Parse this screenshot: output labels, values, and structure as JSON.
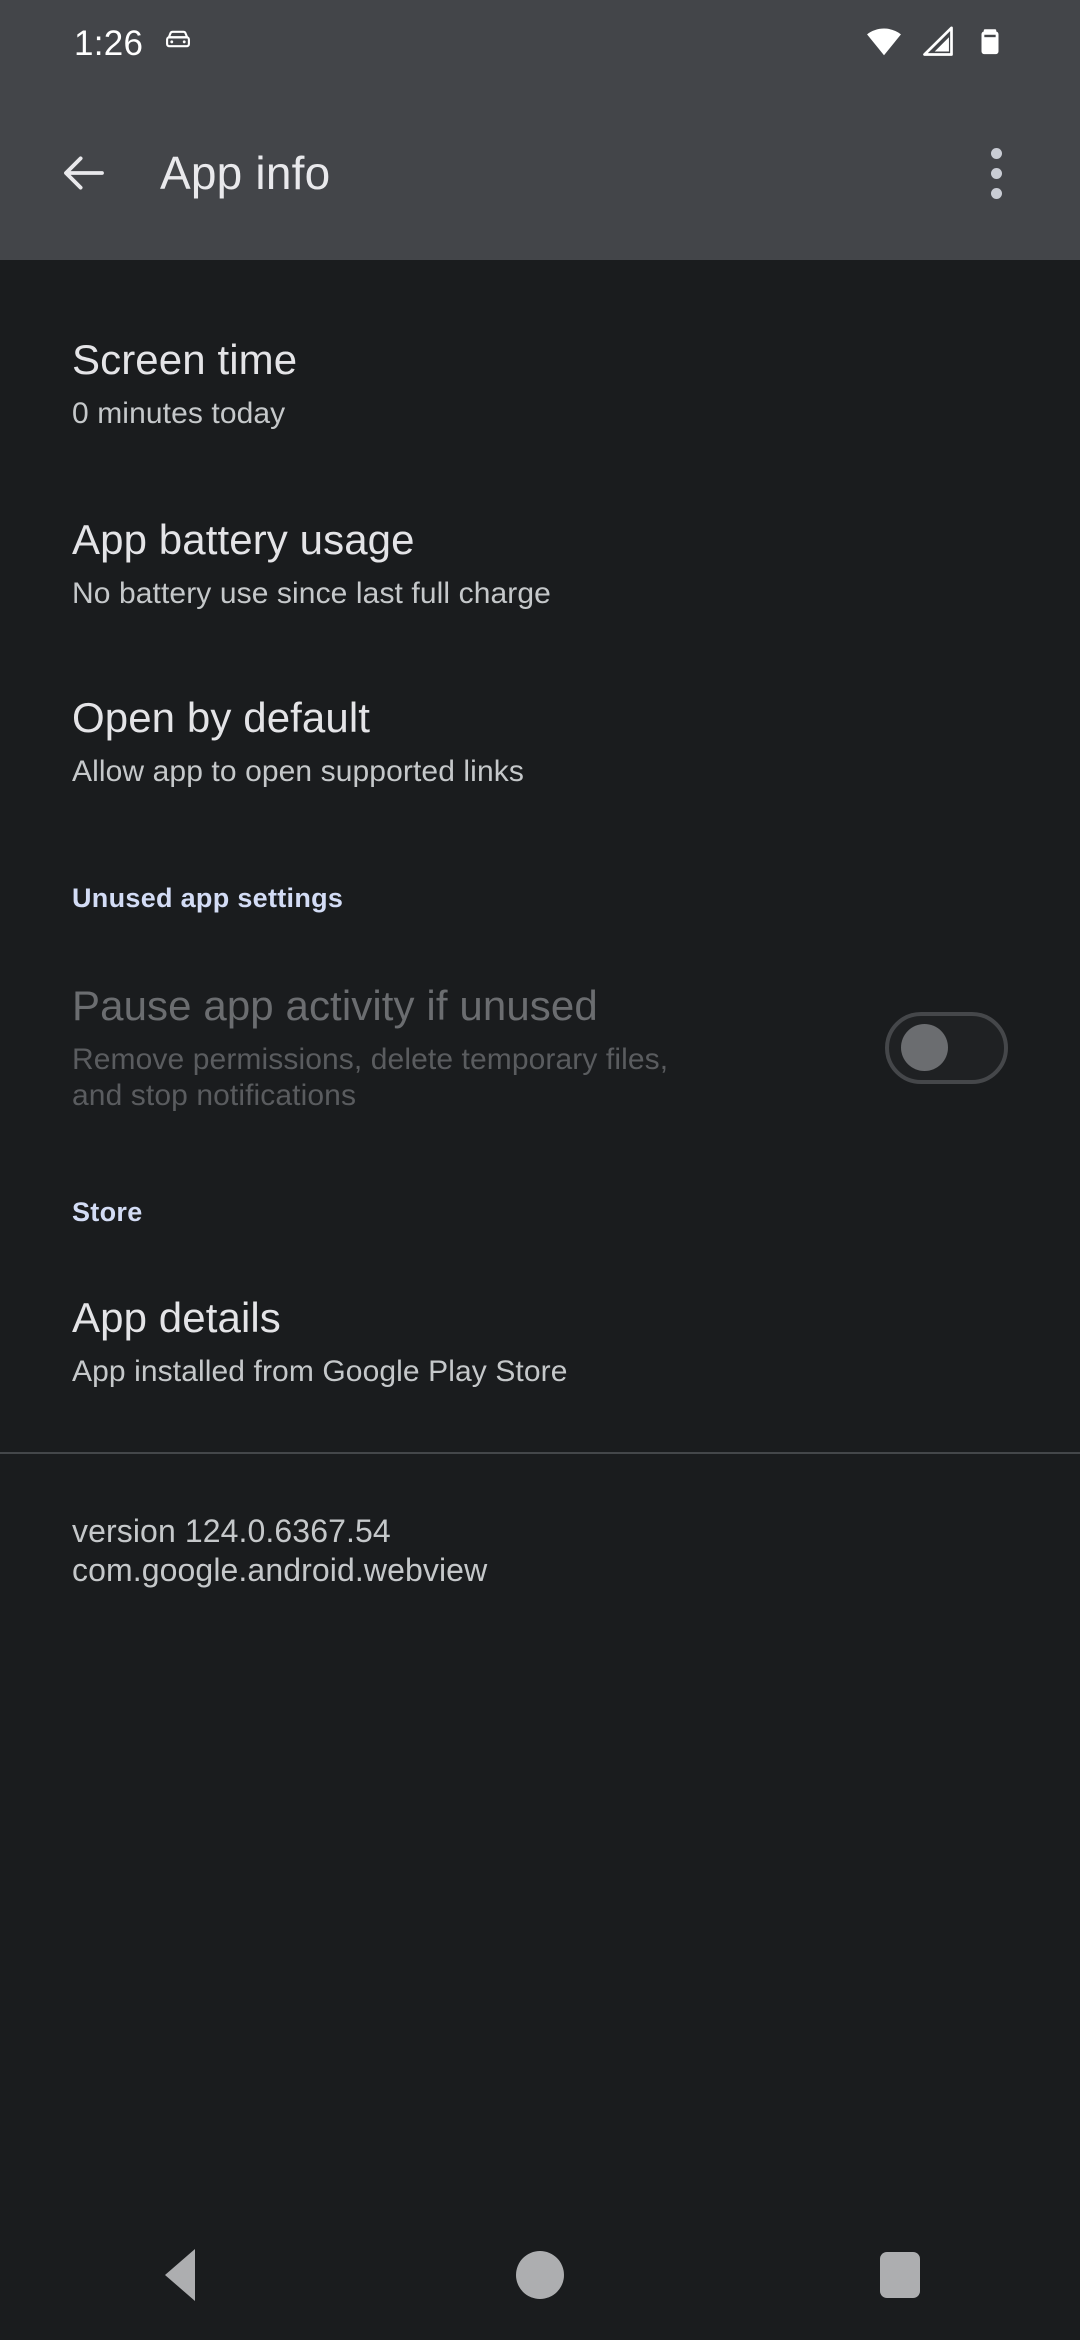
{
  "status_bar": {
    "clock": "1:26",
    "icons": [
      "car-icon",
      "wifi-icon",
      "cellular-signal-icon",
      "battery-icon"
    ]
  },
  "app_bar": {
    "back_label": "back-arrow",
    "title": "App info",
    "overflow_label": "more-options"
  },
  "settings": [
    {
      "title": "Screen time",
      "subtitle": "0 minutes today"
    },
    {
      "title": "App battery usage",
      "subtitle": "No battery use since last full charge"
    },
    {
      "title": "Open by default",
      "subtitle": "Allow app to open supported links"
    }
  ],
  "unused_section": {
    "header": "Unused app settings",
    "row": {
      "title": "Pause app activity if unused",
      "subtitle": "Remove permissions, delete temporary files, and stop notifications",
      "switch_state": "off",
      "disabled": true
    }
  },
  "store_section": {
    "header": "Store",
    "row": {
      "title": "App details",
      "subtitle": "App installed from Google Play Store"
    }
  },
  "footer": {
    "version": "version 124.0.6367.54",
    "package": "com.google.android.webview"
  },
  "nav_bar": {
    "back": "back-nav",
    "home": "home-nav",
    "recents": "recents-nav"
  },
  "colors": {
    "bar_background": "#434549",
    "content_background": "#1a1c1e",
    "accent": "#d3dcf5",
    "title_text": "#e4e4e7",
    "subtitle_text": "#c5c8ca",
    "disabled_title": "#6b6d70",
    "disabled_subtitle": "#5a5c5f"
  }
}
